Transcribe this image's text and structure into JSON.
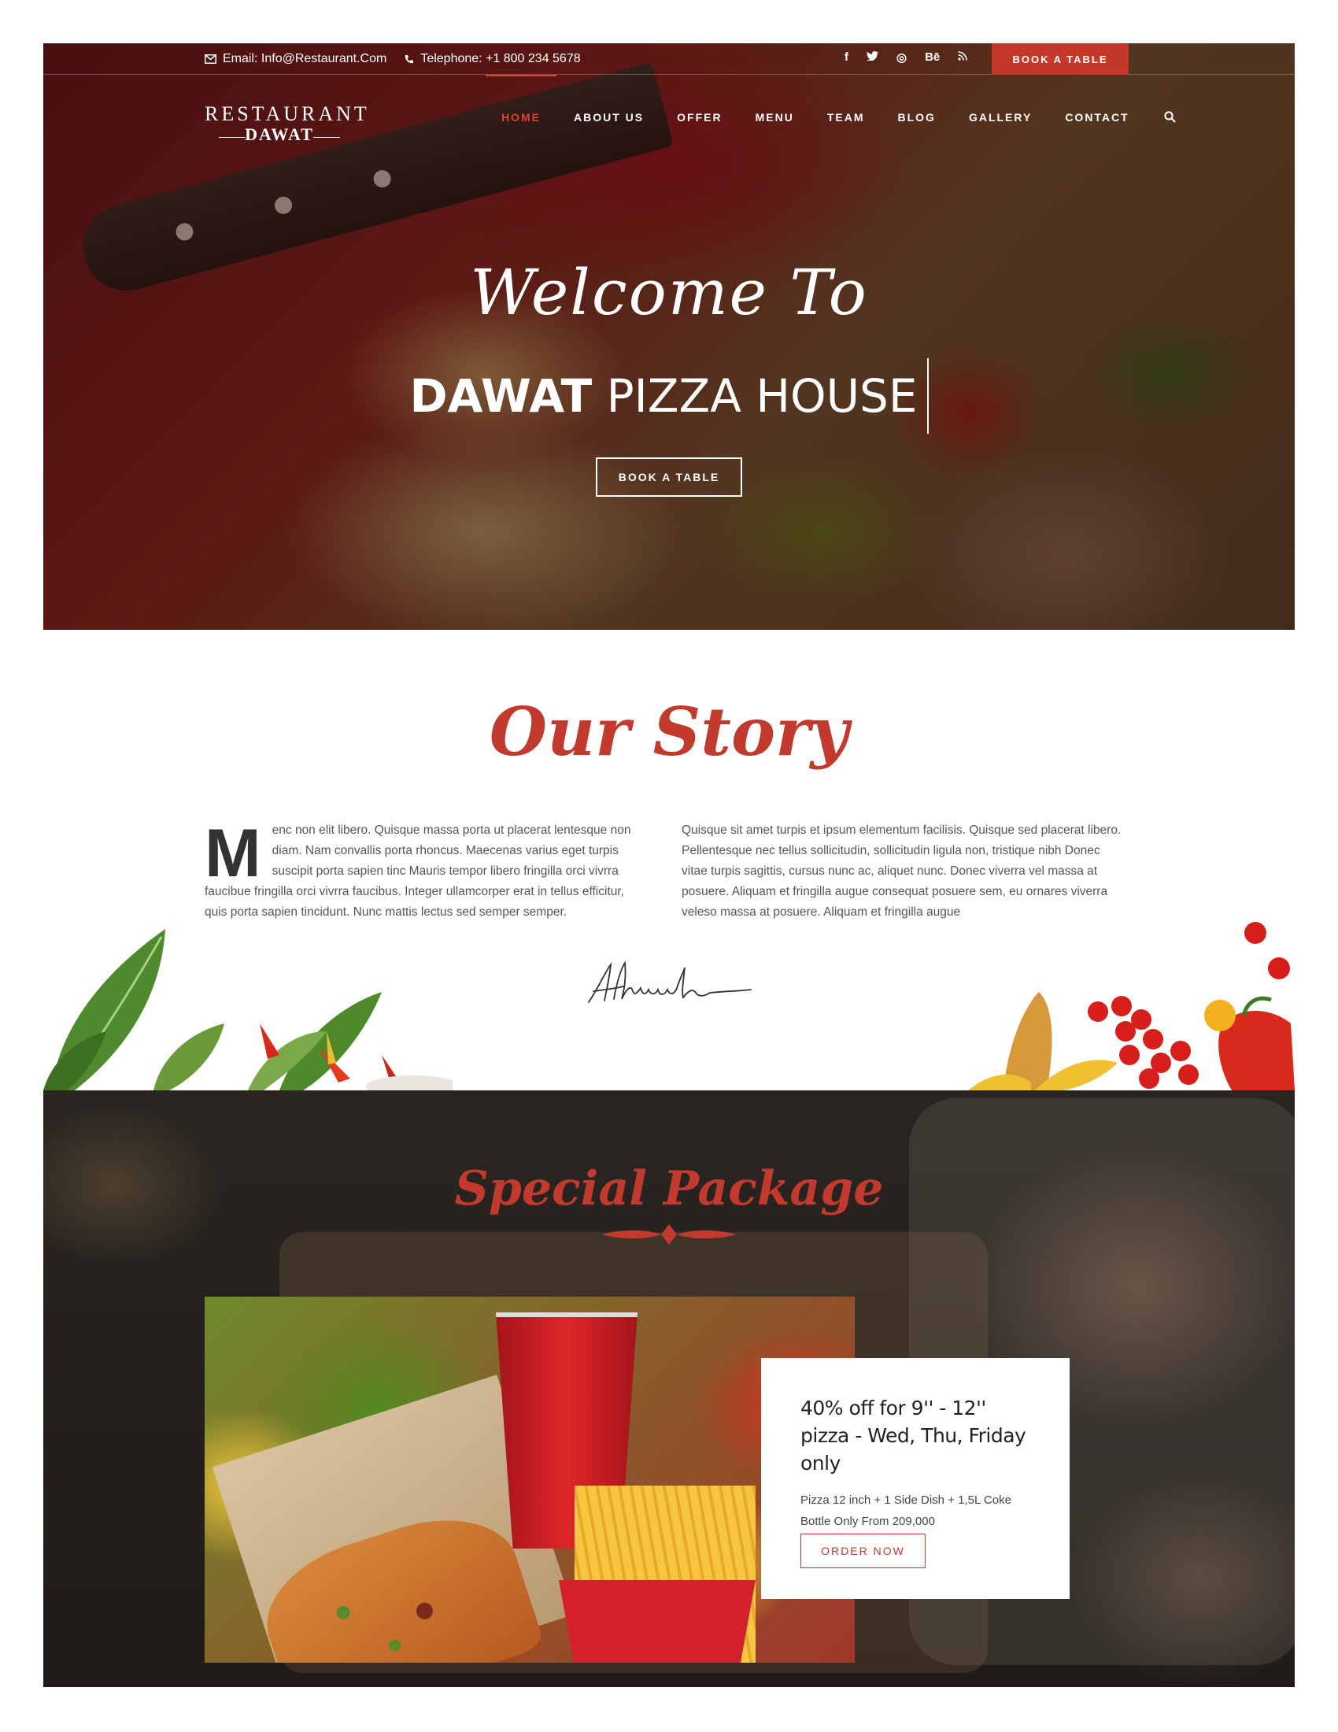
{
  "topbar": {
    "email": "Email: Info@Restaurant.Com",
    "telephone": "Telephone: +1 800 234 5678",
    "social": [
      "f",
      "t",
      "◎",
      "Bē",
      "rss"
    ],
    "book_label": "BOOK A TABLE"
  },
  "logo": {
    "line1": "RESTAURANT",
    "line2": "DAWAT"
  },
  "nav": {
    "items": [
      {
        "label": "HOME",
        "active": true
      },
      {
        "label": "ABOUT US"
      },
      {
        "label": "OFFER"
      },
      {
        "label": "MENU"
      },
      {
        "label": "TEAM"
      },
      {
        "label": "BLOG"
      },
      {
        "label": "GALLERY"
      },
      {
        "label": "CONTACT"
      }
    ]
  },
  "hero": {
    "welcome": "Welcome To",
    "title_bold": "DAWAT",
    "title_rest": " PIZZA HOUSE",
    "button_label": "BOOK A TABLE"
  },
  "story": {
    "title": "Our Story",
    "dropcap": "M",
    "left_text": "enc non elit libero. Quisque massa porta ut placerat lentesque non diam. Nam convallis porta rhoncus. Maecenas varius eget turpis suscipit porta sapien tinc Mauris tempor libero fringilla orci vivrra faucibue fringilla orci vivrra faucibus. Integer ullamcorper erat in tellus efficitur, quis porta sapien tincidunt. Nunc mattis lectus sed semper semper.",
    "right_text": "Quisque sit amet turpis et ipsum elementum facilisis. Quisque sed placerat libero. Pellentesque nec tellus sollicitudin, sollicitudin ligula non, tristique nibh Donec vitae turpis sagittis, cursus nunc ac, aliquet nunc. Donec viverra vel massa at posuere. Aliquam et fringilla augue consequat posuere sem, eu ornares viverra veleso massa at posuere. Aliquam et fringilla augue"
  },
  "special": {
    "title": "Special Package",
    "offer_title": "40% off for 9'' - 12'' pizza - Wed, Thu, Friday only",
    "offer_desc": "Pizza 12 inch + 1 Side Dish + 1,5L Coke Bottle Only From 209,000",
    "order_label": "ORDER NOW"
  },
  "colors": {
    "accent": "#c4382a",
    "script_red": "#c23a2d"
  },
  "icons": {
    "email": "envelope-icon",
    "phone": "phone-icon",
    "search": "search-icon"
  }
}
